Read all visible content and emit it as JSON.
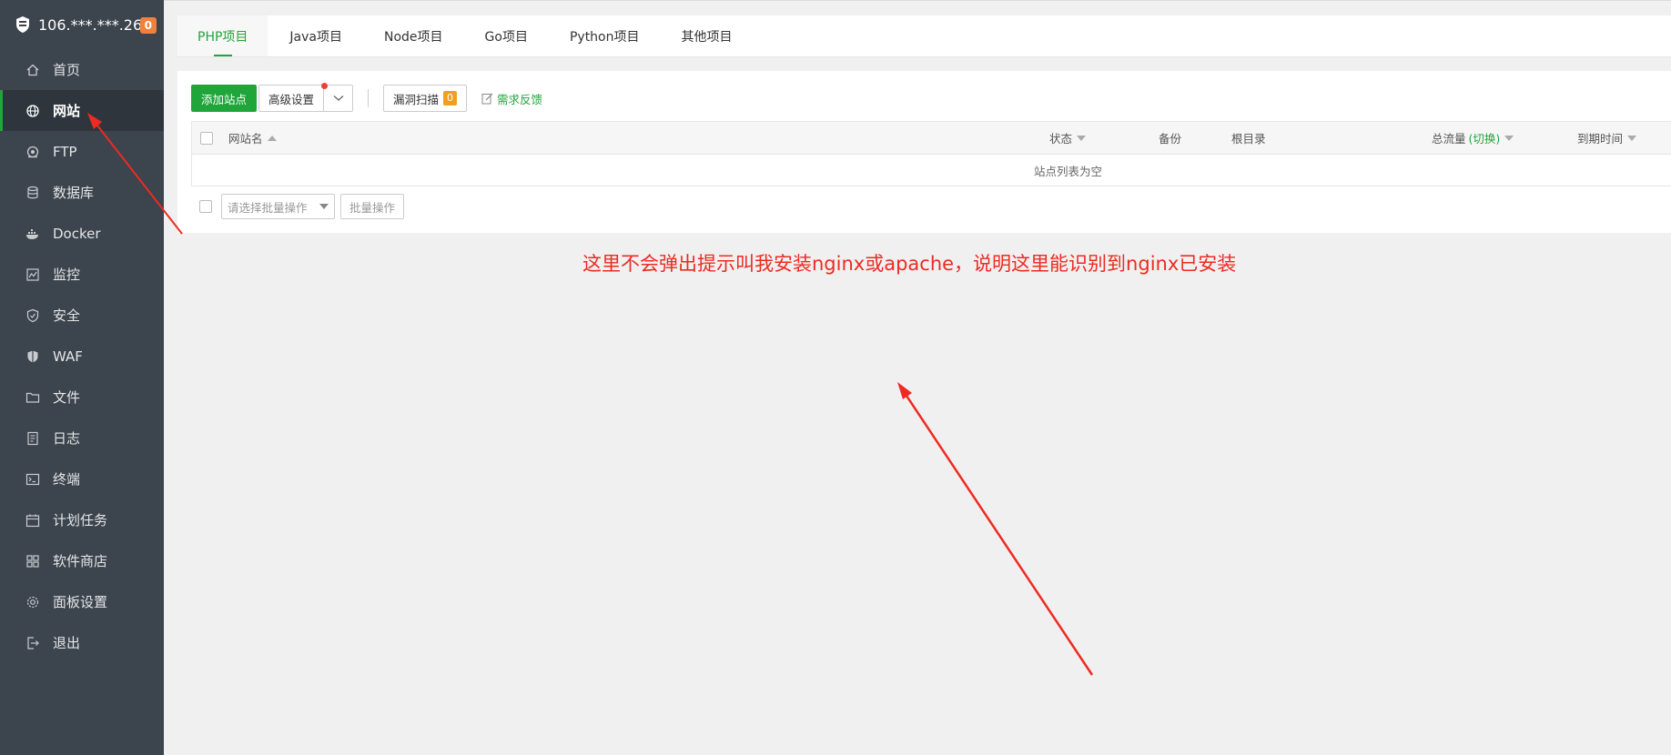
{
  "sidebar": {
    "server": "106.***.***.26",
    "badge": "0",
    "items": [
      {
        "label": "首页",
        "icon": "home-icon"
      },
      {
        "label": "网站",
        "icon": "globe-icon",
        "active": true
      },
      {
        "label": "FTP",
        "icon": "ftp-icon"
      },
      {
        "label": "数据库",
        "icon": "database-icon"
      },
      {
        "label": "Docker",
        "icon": "docker-icon"
      },
      {
        "label": "监控",
        "icon": "monitor-icon"
      },
      {
        "label": "安全",
        "icon": "shield-check-icon"
      },
      {
        "label": "WAF",
        "icon": "waf-shield-icon"
      },
      {
        "label": "文件",
        "icon": "folder-icon"
      },
      {
        "label": "日志",
        "icon": "log-icon"
      },
      {
        "label": "终端",
        "icon": "terminal-icon"
      },
      {
        "label": "计划任务",
        "icon": "calendar-icon"
      },
      {
        "label": "软件商店",
        "icon": "apps-icon"
      },
      {
        "label": "面板设置",
        "icon": "gear-icon"
      },
      {
        "label": "退出",
        "icon": "logout-icon"
      }
    ]
  },
  "tabs": [
    "PHP项目",
    "Java项目",
    "Node项目",
    "Go项目",
    "Python项目",
    "其他项目"
  ],
  "toolbar": {
    "add_site": "添加站点",
    "advanced": "高级设置",
    "scan": "漏洞扫描",
    "scan_count": "0",
    "feedback": "需求反馈"
  },
  "table": {
    "headers": {
      "name": "网站名",
      "status": "状态",
      "backup": "备份",
      "root": "根目录",
      "traffic": "总流量",
      "traffic_switch": "(切换)",
      "expire": "到期时间"
    },
    "empty": "站点列表为空"
  },
  "batch": {
    "placeholder": "请选择批量操作",
    "button": "批量操作"
  },
  "annotation": {
    "text": "这里不会弹出提示叫我安装nginx或apache，说明这里能识别到nginx已安装",
    "color": "#ee2a22"
  },
  "colors": {
    "sidebar_bg": "#3c444d",
    "accent": "#20a53a"
  }
}
